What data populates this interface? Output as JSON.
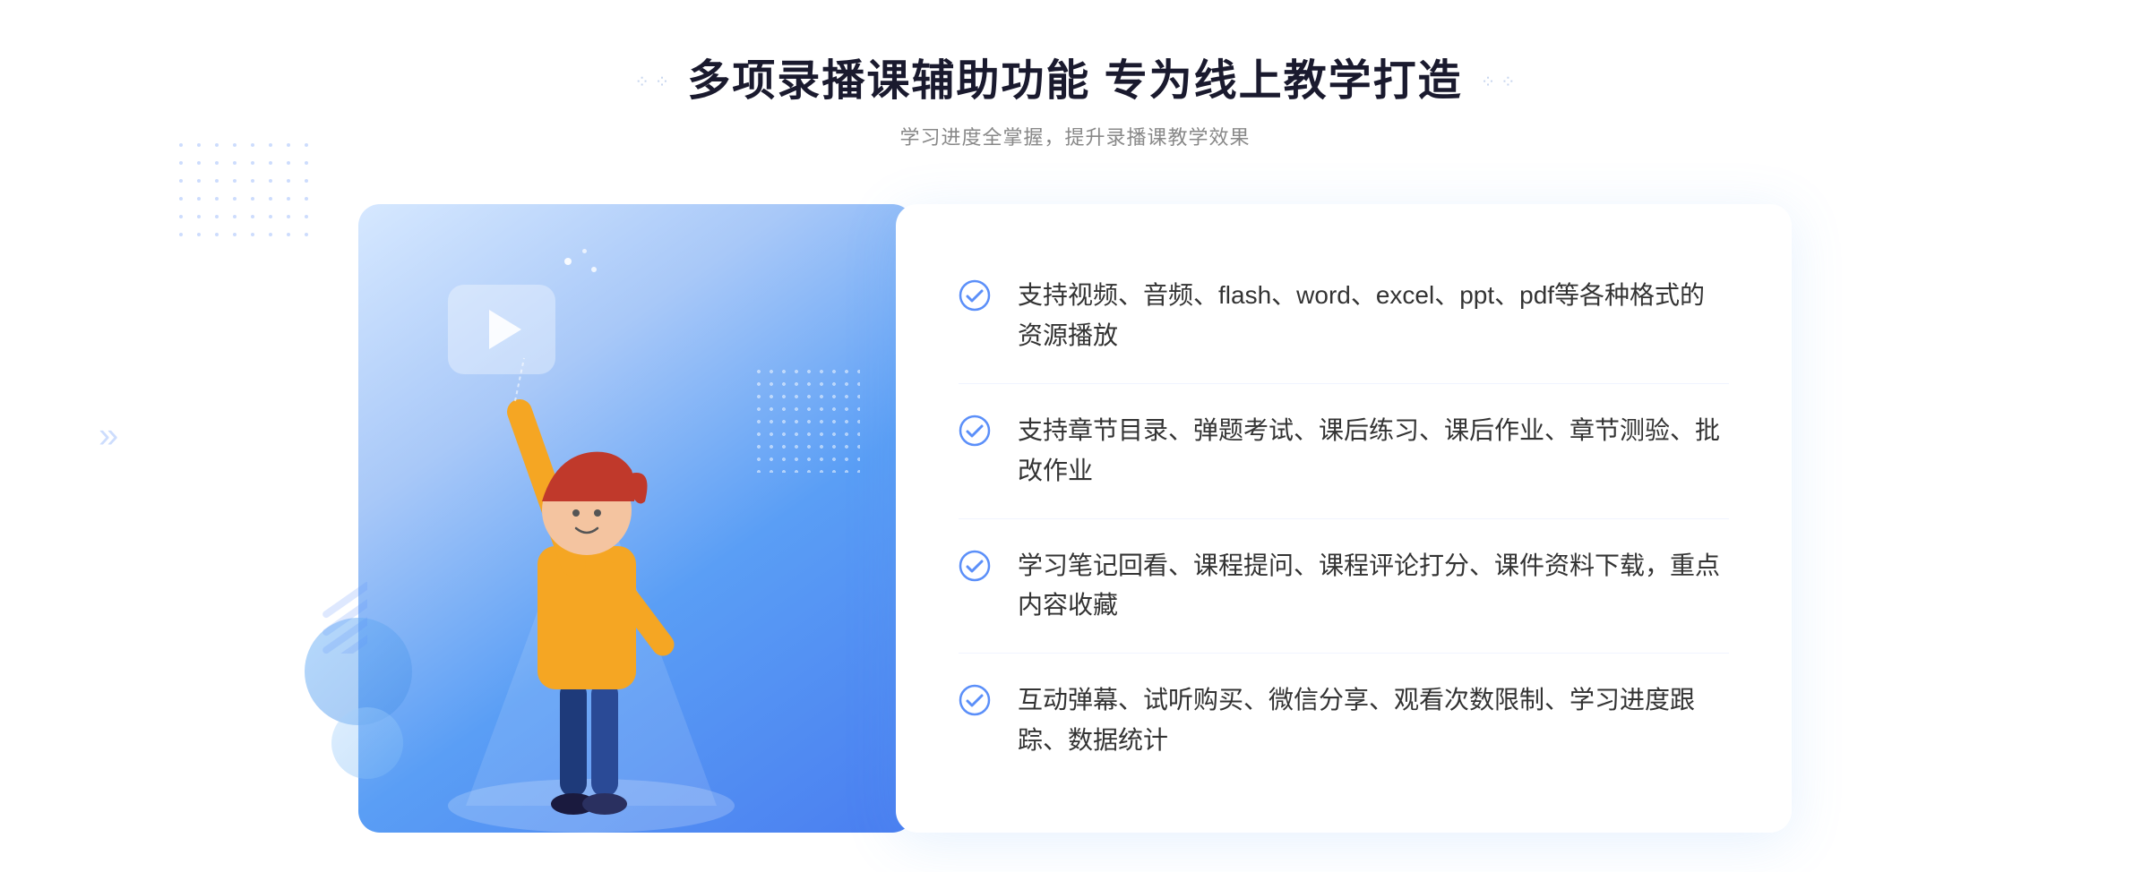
{
  "page": {
    "title": "多项录播课辅助功能 专为线上教学打造",
    "subtitle": "学习进度全掌握，提升录播课教学效果",
    "features": [
      {
        "id": "feature-1",
        "text": "支持视频、音频、flash、word、excel、ppt、pdf等各种格式的资源播放"
      },
      {
        "id": "feature-2",
        "text": "支持章节目录、弹题考试、课后练习、课后作业、章节测验、批改作业"
      },
      {
        "id": "feature-3",
        "text": "学习笔记回看、课程提问、课程评论打分、课件资料下载，重点内容收藏"
      },
      {
        "id": "feature-4",
        "text": "互动弹幕、试听购买、微信分享、观看次数限制、学习进度跟踪、数据统计"
      }
    ],
    "colors": {
      "primary": "#4a7ef0",
      "accent": "#5b8ff9",
      "text_dark": "#1a1a2e",
      "text_gray": "#888888",
      "text_body": "#333333",
      "check_color": "#5b8ff9"
    },
    "icons": {
      "check": "check-circle-icon",
      "play": "play-icon",
      "left_arrow": "left-arrow-icon"
    },
    "decorations": {
      "left_arrows": "»",
      "dots_separator_left": "⁘",
      "dots_separator_right": "⁘"
    }
  }
}
